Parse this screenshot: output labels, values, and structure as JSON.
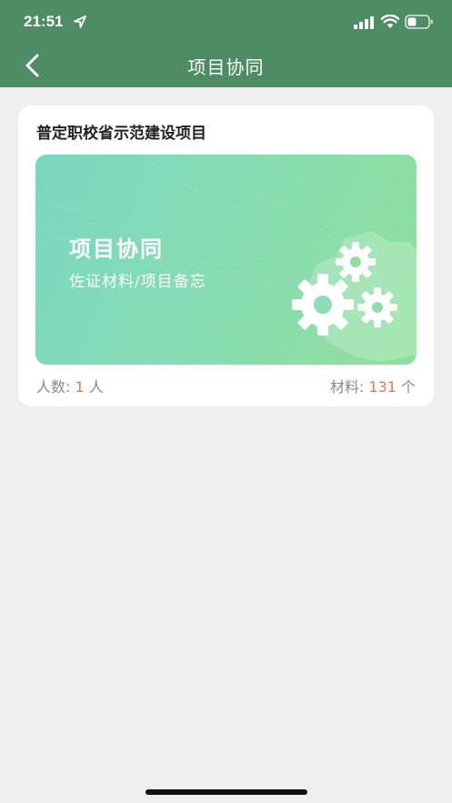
{
  "status": {
    "time": "21:51"
  },
  "nav": {
    "title": "项目协同",
    "back_icon": "chevron-left-icon"
  },
  "project_card": {
    "title": "普定职校省示范建设项目",
    "banner": {
      "title": "项目协同",
      "subtitle": "佐证材料/项目备忘",
      "icon": "gears-icon"
    },
    "members": {
      "label": "人数: ",
      "value": "1",
      "unit": " 人"
    },
    "materials": {
      "label": "材料: ",
      "value": "131",
      "unit": " 个"
    }
  },
  "colors": {
    "header": "#4e8c63",
    "accent_number": "#e07a4f",
    "background": "#efefef"
  }
}
